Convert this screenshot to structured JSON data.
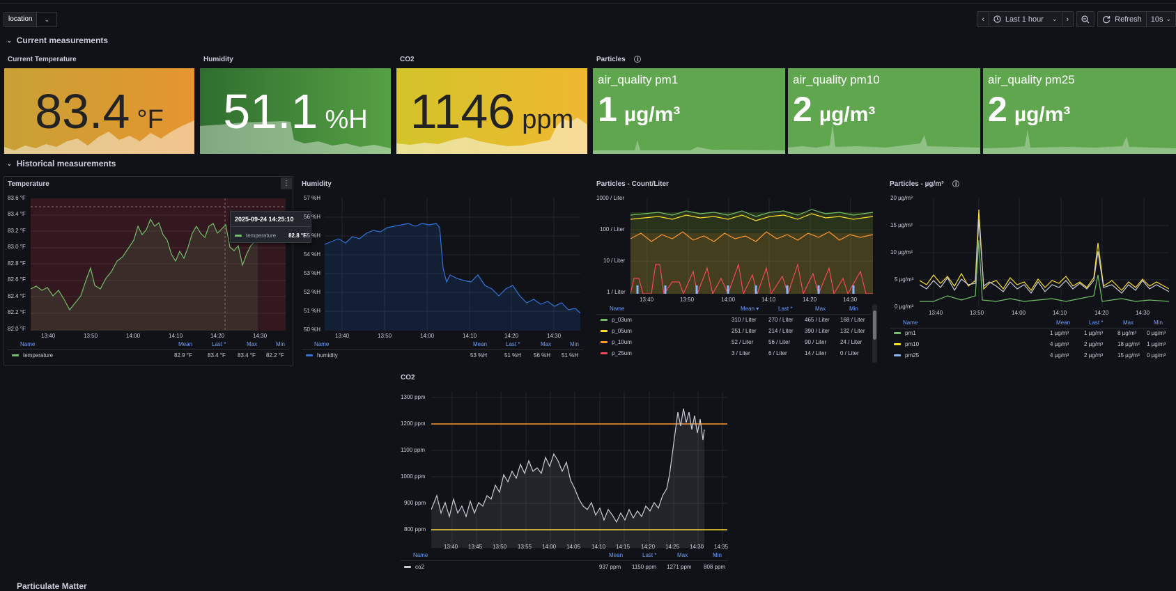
{
  "toolbar": {
    "variable_label": "location",
    "time_range": "Last 1 hour",
    "refresh_label": "Refresh",
    "refresh_interval": "10s"
  },
  "rows": {
    "current": "Current measurements",
    "historical": "Historical measurements",
    "bottom": "Particulate Matter"
  },
  "stats": {
    "temperature": {
      "title": "Current Temperature",
      "value": "83.4",
      "unit": "°F",
      "color_from": "#c8a135",
      "color_to": "#e69530"
    },
    "humidity": {
      "title": "Humidity",
      "value": "51.1",
      "unit": "%H",
      "color_from": "#2f6e2f",
      "color_to": "#56a044"
    },
    "co2": {
      "title": "CO2",
      "value": "1146",
      "unit": "ppm",
      "color_from": "#d3c42b",
      "color_to": "#f0b830"
    },
    "particles_title": "Particles",
    "pm1": {
      "title": "air_quality pm1",
      "value": "1",
      "unit": "µg/m³"
    },
    "pm10": {
      "title": "air_quality pm10",
      "value": "2",
      "unit": "µg/m³"
    },
    "pm25": {
      "title": "air_quality pm25",
      "value": "2",
      "unit": "µg/m³"
    }
  },
  "legend_headers": {
    "name": "Name",
    "mean": "Mean",
    "last": "Last *",
    "max": "Max",
    "min": "Min",
    "mean_sorted": "Mean ▾"
  },
  "temperature_panel": {
    "title": "Temperature",
    "y_ticks": [
      "83.6 °F",
      "83.4 °F",
      "83.2 °F",
      "83.0 °F",
      "82.8 °F",
      "82.6 °F",
      "82.4 °F",
      "82.2 °F",
      "82.0 °F"
    ],
    "x_ticks": [
      "13:40",
      "13:50",
      "14:00",
      "14:10",
      "14:20",
      "14:30"
    ],
    "legend": {
      "name": "temperature",
      "mean": "82.9 °F",
      "last": "83.4 °F",
      "max": "83.4 °F",
      "min": "82.2 °F"
    },
    "tooltip": {
      "time": "2025-09-24 14:25:10",
      "series": "temperature",
      "value": "82.8 °F"
    }
  },
  "humidity_panel": {
    "title": "Humidity",
    "y_ticks": [
      "57 %H",
      "56 %H",
      "55 %H",
      "54 %H",
      "53 %H",
      "52 %H",
      "51 %H",
      "50 %H"
    ],
    "x_ticks": [
      "13:40",
      "13:50",
      "14:00",
      "14:10",
      "14:20",
      "14:30"
    ],
    "legend": {
      "name": "humidity",
      "mean": "53 %H",
      "last": "51 %H",
      "max": "56 %H",
      "min": "51 %H"
    }
  },
  "particles_count_panel": {
    "title": "Particles - Count/Liter",
    "y_ticks": [
      "1000 / Liter",
      "100 / Liter",
      "10 / Liter",
      "1 / Liter"
    ],
    "x_ticks": [
      "13:40",
      "13:50",
      "14:00",
      "14:10",
      "14:20",
      "14:30"
    ],
    "legend": [
      {
        "name": "p_03um",
        "color": "#73bf69",
        "mean": "310 / Liter",
        "last": "270 / Liter",
        "max": "465 / Liter",
        "min": "168 / Liter"
      },
      {
        "name": "p_05um",
        "color": "#fade2a",
        "mean": "251 / Liter",
        "last": "214 / Liter",
        "max": "390 / Liter",
        "min": "132 / Liter"
      },
      {
        "name": "p_10um",
        "color": "#ff9830",
        "mean": "52 / Liter",
        "last": "56 / Liter",
        "max": "90 / Liter",
        "min": "24 / Liter"
      },
      {
        "name": "p_25um",
        "color": "#f2495c",
        "mean": "3 / Liter",
        "last": "6 / Liter",
        "max": "14 / Liter",
        "min": "0 / Liter"
      }
    ]
  },
  "particles_mass_panel": {
    "title": "Particles - µg/m³",
    "y_ticks": [
      "20 µg/m³",
      "15 µg/m³",
      "10 µg/m³",
      "5 µg/m³",
      "0 µg/m³"
    ],
    "x_ticks": [
      "13:40",
      "13:50",
      "14:00",
      "14:10",
      "14:20",
      "14:30"
    ],
    "legend": [
      {
        "name": "pm1",
        "color": "#73bf69",
        "mean": "1 µg/m³",
        "last": "1 µg/m³",
        "max": "8 µg/m³",
        "min": "0 µg/m³"
      },
      {
        "name": "pm10",
        "color": "#fade2a",
        "mean": "4 µg/m³",
        "last": "2 µg/m³",
        "max": "18 µg/m³",
        "min": "1 µg/m³"
      },
      {
        "name": "pm25",
        "color": "#8ab8ff",
        "mean": "4 µg/m³",
        "last": "2 µg/m³",
        "max": "15 µg/m³",
        "min": "0 µg/m³"
      }
    ]
  },
  "co2_panel": {
    "title": "CO2",
    "y_ticks": [
      "1300 ppm",
      "1200 ppm",
      "1100 ppm",
      "1000 ppm",
      "900 ppm",
      "800 ppm"
    ],
    "x_ticks": [
      "13:40",
      "13:45",
      "13:50",
      "13:55",
      "14:00",
      "14:05",
      "14:10",
      "14:15",
      "14:20",
      "14:25",
      "14:30",
      "14:35"
    ],
    "legend": {
      "name": "co2",
      "mean": "937 ppm",
      "last": "1150 ppm",
      "max": "1271 ppm",
      "min": "808 ppm"
    }
  }
}
